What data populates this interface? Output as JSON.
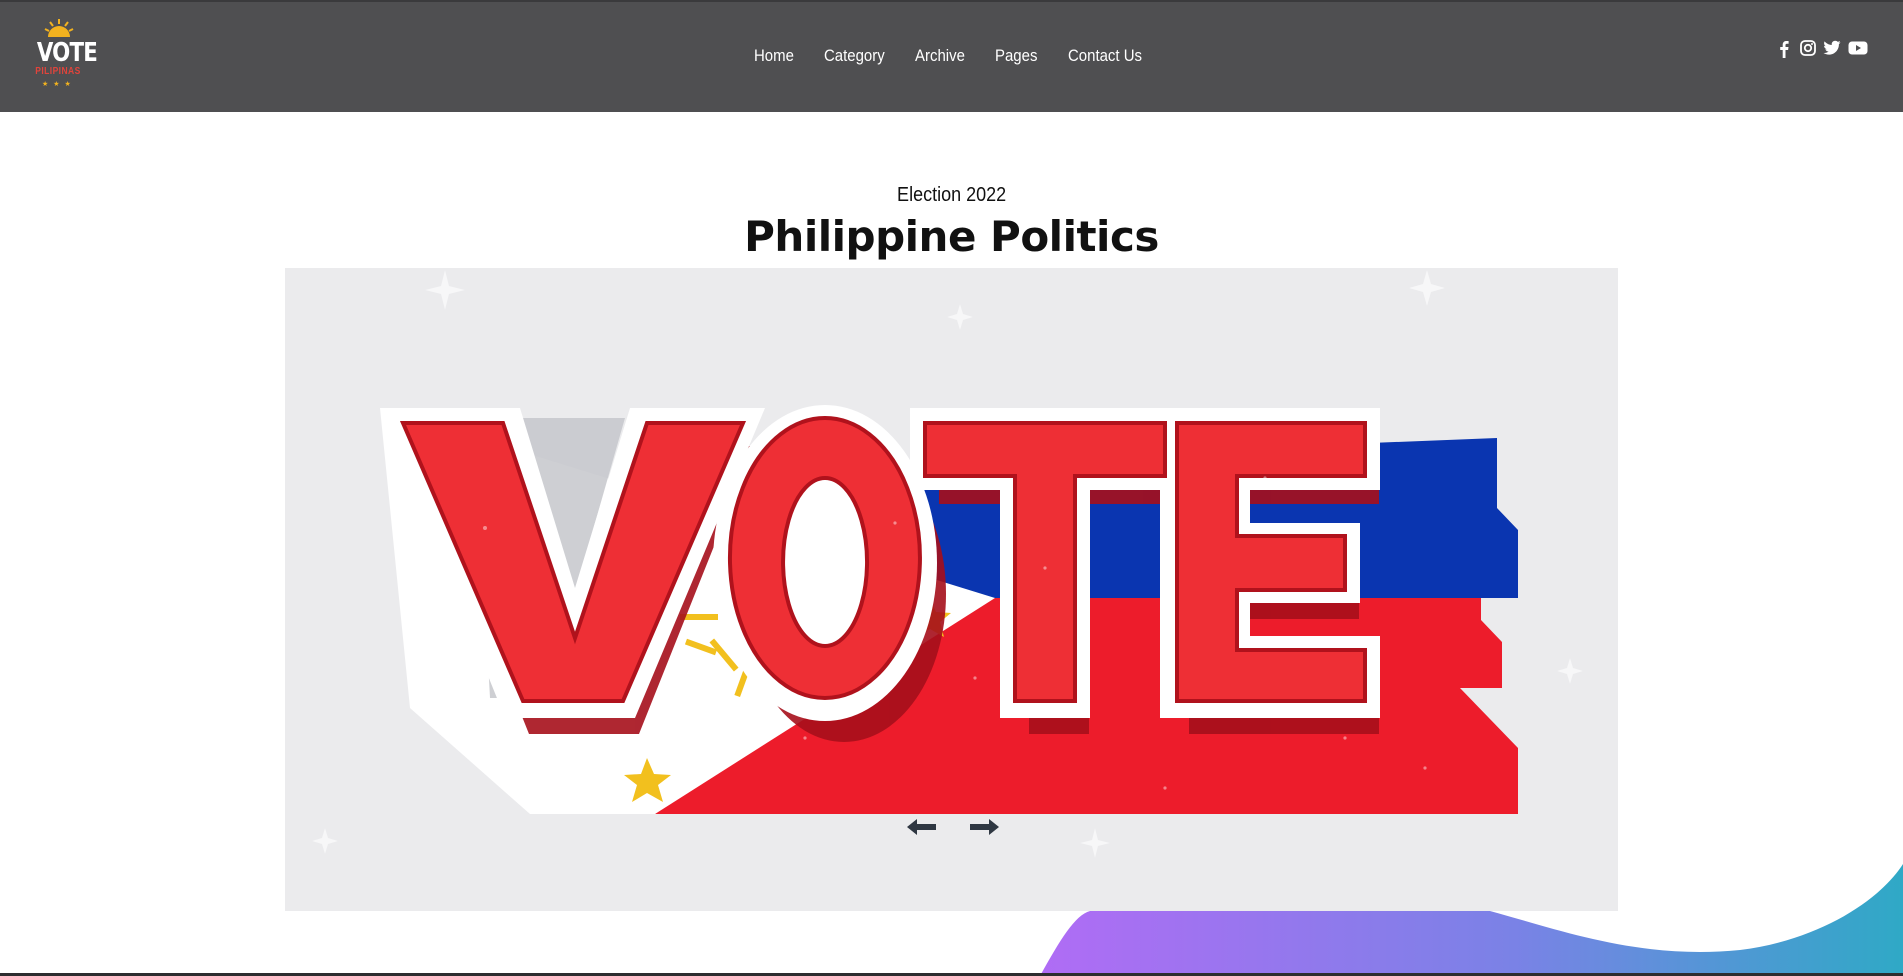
{
  "header": {
    "logo": {
      "word": "VOTE",
      "sub": "PILIPINAS"
    },
    "nav": [
      {
        "label": "Home"
      },
      {
        "label": "Category"
      },
      {
        "label": "Archive"
      },
      {
        "label": "Pages"
      },
      {
        "label": "Contact Us"
      }
    ],
    "social": [
      {
        "icon": "facebook-icon"
      },
      {
        "icon": "instagram-icon"
      },
      {
        "icon": "twitter-icon"
      },
      {
        "icon": "youtube-icon"
      }
    ]
  },
  "hero": {
    "kicker": "Election 2022",
    "title": "Philippine Politics"
  },
  "slider": {
    "image_text": "VOTE",
    "prev_icon": "arrow-left-icon",
    "next_icon": "arrow-right-icon"
  },
  "colors": {
    "header_bg": "#4f4f51",
    "flag_red": "#ed1c2b",
    "flag_blue": "#0a35b0",
    "flag_yellow": "#f2c01e",
    "wave_start": "#b06cf5",
    "wave_end": "#2fa9c6"
  }
}
